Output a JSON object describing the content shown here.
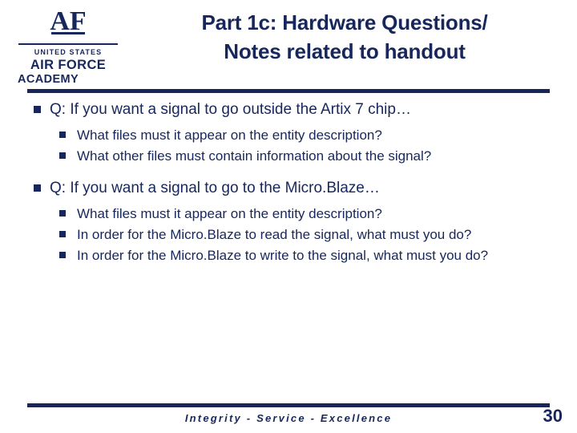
{
  "logo": {
    "monogram": "AF",
    "line1": "UNITED STATES",
    "line2": "AIR FORCE",
    "line3": "ACADEMY"
  },
  "title": {
    "line1": "Part 1c: Hardware Questions/",
    "line2": "Notes related to handout"
  },
  "content": [
    {
      "level1": "Q: If you want a signal to go outside the Artix 7 chip…",
      "level2": [
        "What files must it appear on the entity description?",
        "What other files must contain information about the signal?"
      ]
    },
    {
      "level1": "Q: If you want a signal to go to the Micro.Blaze…",
      "level2": [
        "What files must it appear on the entity description?",
        "In order for the Micro.Blaze to read the signal, what must you do?",
        "In order for the Micro.Blaze to write to the signal, what must you do?"
      ]
    }
  ],
  "footer": {
    "motto": "Integrity - Service - Excellence",
    "page_number": "30"
  },
  "colors": {
    "navy": "#17275c"
  }
}
